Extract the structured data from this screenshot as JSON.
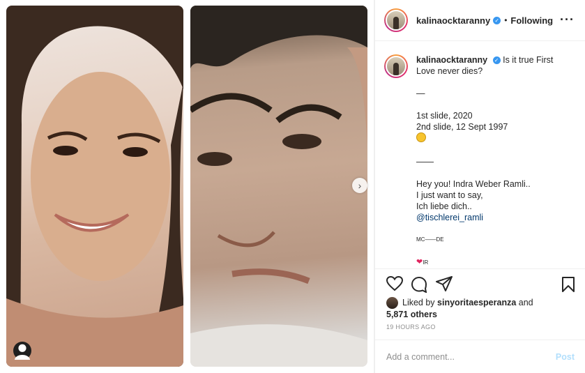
{
  "post": {
    "username": "kalinaocktaranny",
    "follow_label": "Following",
    "more_label": "•••",
    "caption_username": "kalinaocktaranny",
    "caption_lines": [
      "Is it true First",
      "Love never dies?",
      "",
      "—",
      "",
      "1st slide, 2020",
      "2nd slide, 12 Sept 1997",
      ""
    ],
    "divider2": "——",
    "message_lines": [
      "Hey you! Indra Weber Ramli..",
      "I just want to say,",
      "Ich liebe dich.."
    ],
    "mention": "@tischlerei_ramli",
    "signoff": "MC——DE",
    "signoff2": "IR",
    "liked_by_prefix": "Liked by",
    "liked_by_user": "sinyoritaesperanza",
    "liked_by_and": "and",
    "others": "5,871 others",
    "timestamp": "19 HOURS AGO",
    "comment_placeholder": "Add a comment...",
    "post_button": "Post"
  },
  "colors": {
    "verified": "#3897f0",
    "link": "#00376b",
    "post_disabled": "#b2dffc"
  }
}
